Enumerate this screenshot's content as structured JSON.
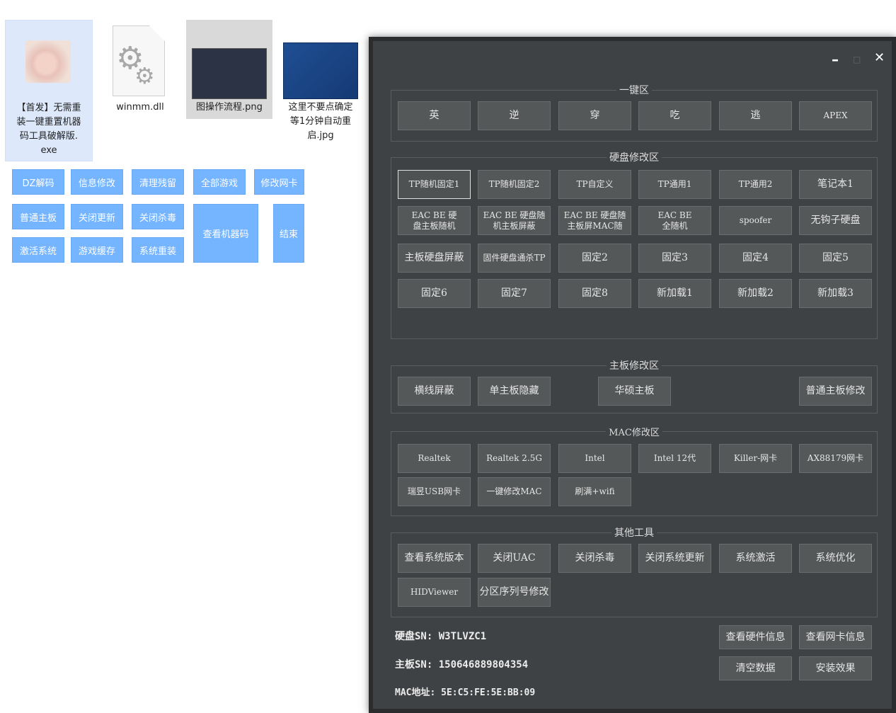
{
  "desktop_files": [
    {
      "name": "【首发】无需重\n装一键重置机器\n码工具破解版.\nexe",
      "icon": "photo-thumbnail"
    },
    {
      "name": "winmm.dll",
      "icon": "gear-file-icon"
    },
    {
      "name": "图操作流程.png",
      "icon": "image-thumbnail"
    },
    {
      "name": "这里不要点确定\n等1分钟自动重\n启.jpg",
      "icon": "image-thumbnail"
    }
  ],
  "blue_buttons": [
    "DZ解码",
    "信息修改",
    "清理残留",
    "全部游戏",
    "修改网卡",
    "普通主板",
    "关闭更新",
    "关闭杀毒",
    "查看机器码",
    "结束",
    "激活系统",
    "游戏缓存",
    "系统重装"
  ],
  "window": {
    "controls": {
      "minimize": "–",
      "maximize": "□",
      "close": "✕"
    },
    "groups": {
      "one_key": {
        "title": "一键区",
        "buttons": [
          "英",
          "逆",
          "穿",
          "吃",
          "逃",
          "APEX"
        ]
      },
      "disk": {
        "title": "硬盘修改区",
        "buttons": [
          "TP随机固定1",
          "TP随机固定2",
          "TP自定义",
          "TP通用1",
          "TP通用2",
          "笔记本1",
          "EAC BE 硬\n盘主板随机",
          "EAC BE 硬盘随\n机主板屏蔽",
          "EAC BE 硬盘随\n主板屏MAC随",
          "EAC BE\n全随机",
          "spoofer",
          "无钩子硬盘",
          "主板硬盘屏蔽",
          "固件硬盘通杀TP",
          "固定2",
          "固定3",
          "固定4",
          "固定5",
          "固定6",
          "固定7",
          "固定8",
          "新加载1",
          "新加载2",
          "新加载3"
        ]
      },
      "board": {
        "title": "主板修改区",
        "buttons": [
          "横线屏蔽",
          "单主板隐藏",
          "华硕主板",
          "普通主板修改"
        ]
      },
      "mac": {
        "title": "MAC修改区",
        "buttons": [
          "Realtek",
          "Realtek 2.5G",
          "Intel",
          "Intel 12代",
          "Killer-网卡",
          "AX88179网卡",
          "瑞昱USB网卡",
          "一键修改MAC",
          "刷满+wifi"
        ]
      },
      "tools": {
        "title": "其他工具",
        "buttons": [
          "查看系统版本",
          "关闭UAC",
          "关闭杀毒",
          "关闭系统更新",
          "系统激活",
          "系统优化",
          "HIDViewer",
          "分区序列号修改"
        ]
      }
    },
    "info": {
      "disk_sn": "硬盘SN: W3TLVZC1",
      "board_sn": "主板SN: 150646889804354",
      "mac": "MAC地址: 5E:C5:FE:5E:BB:09"
    },
    "bottom_buttons": [
      "查看硬件信息",
      "查看网卡信息",
      "清空数据",
      "安装效果"
    ]
  }
}
